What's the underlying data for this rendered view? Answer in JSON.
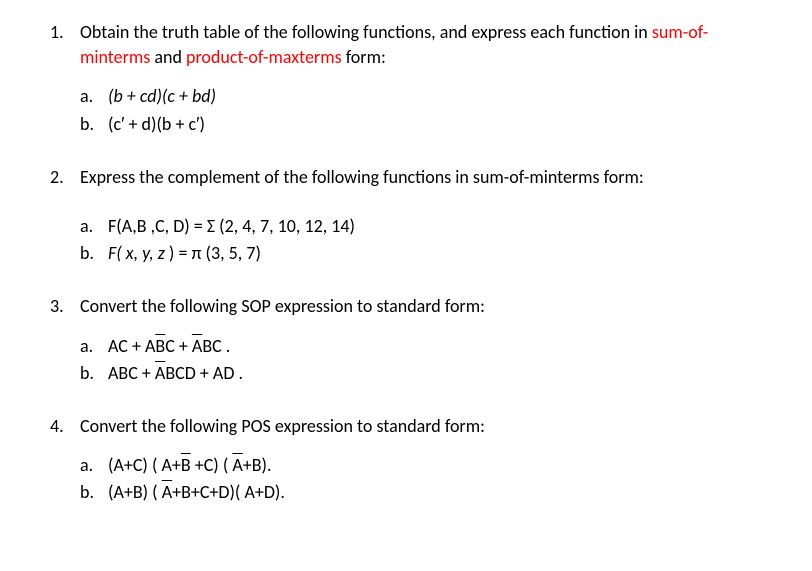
{
  "q1": {
    "number": "1.",
    "text_part1": "Obtain the truth table of the following functions, and express each function in ",
    "text_red1": "sum-of-minterms",
    "text_mid": " and ",
    "text_red2": "product-of-maxterms",
    "text_end": " form:",
    "a_letter": "a.",
    "a_text": "(b + cd)(c + bd)",
    "b_letter": "b.",
    "b_text": "(c′ + d)(b + c′)"
  },
  "q2": {
    "number": "2.",
    "text": "Express the complement of the following functions in sum-of-minterms form:",
    "a_letter": "a.",
    "a_text": "F(A,B ,C, D) = Σ (2, 4, 7, 10, 12, 14)",
    "b_letter": "b.",
    "b_prefix": "F( x, y, z",
    "b_suffix": " ) = π (3, 5, 7)"
  },
  "q3": {
    "number": "3.",
    "text": "Convert the following SOP expression to standard form:",
    "a_letter": "a.",
    "a_p1": "AC + A",
    "a_p2": "B",
    "a_p3": "C + ",
    "a_p4": "A",
    "a_p5": "BC .",
    "b_letter": "b.",
    "b_p1": "ABC + ",
    "b_p2": "A",
    "b_p3": "BCD + AD ."
  },
  "q4": {
    "number": "4.",
    "text": "Convert the following POS expression to standard form:",
    "a_letter": "a.",
    "a_p1": "(A+C) ( A+",
    "a_p2": "B",
    "a_p3": " +C) ( ",
    "a_p4": "A",
    "a_p5": "+B).",
    "b_letter": "b.",
    "b_p1": "(A+B) ( ",
    "b_p2": "A",
    "b_p3": "+B+C+D)( A+D)."
  }
}
